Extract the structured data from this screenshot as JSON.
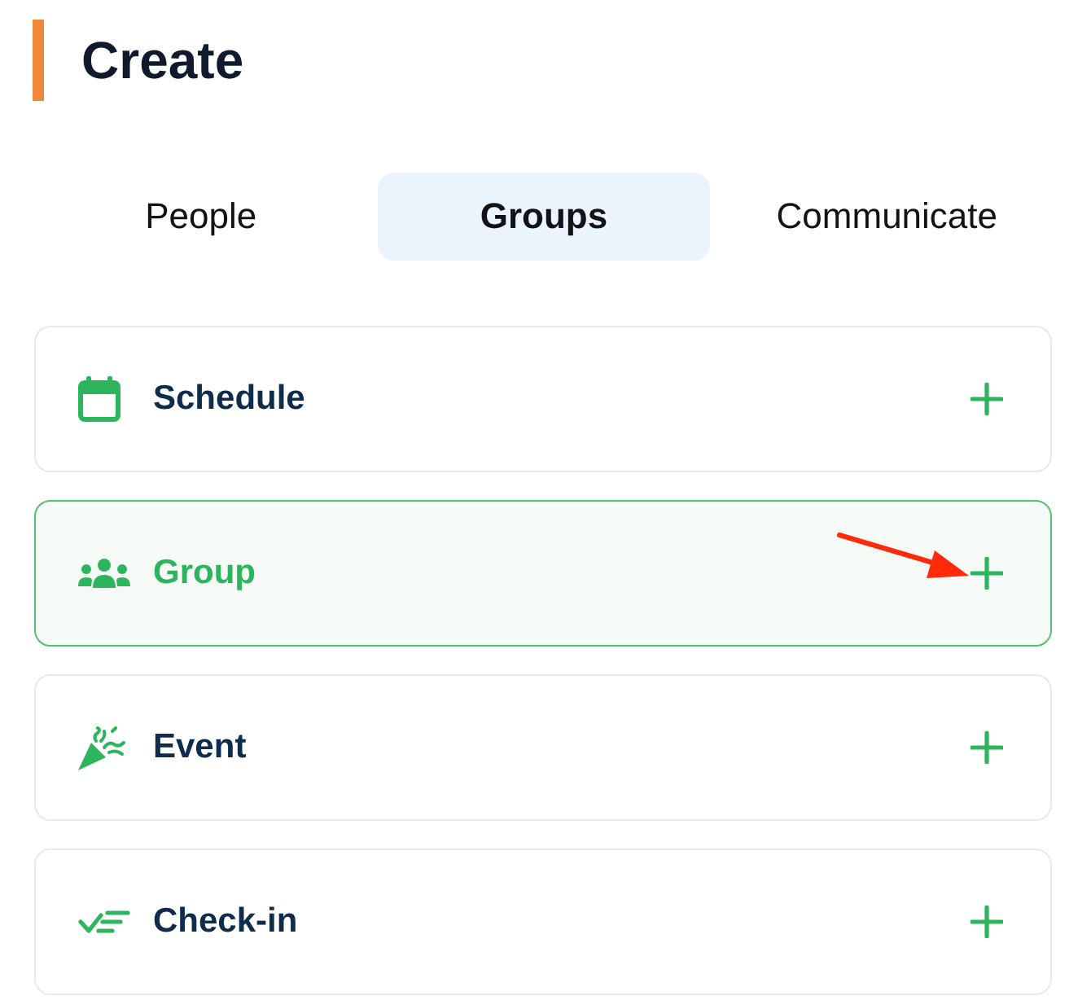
{
  "header": {
    "title": "Create"
  },
  "tabs": [
    {
      "label": "People",
      "selected": false
    },
    {
      "label": "Groups",
      "selected": true
    },
    {
      "label": "Communicate",
      "selected": false
    }
  ],
  "items": [
    {
      "kind": "schedule",
      "label": "Schedule",
      "selected": false,
      "arrow": false
    },
    {
      "kind": "group",
      "label": "Group",
      "selected": true,
      "arrow": true
    },
    {
      "kind": "event",
      "label": "Event",
      "selected": false,
      "arrow": false
    },
    {
      "kind": "checkin",
      "label": "Check-in",
      "selected": false,
      "arrow": false
    }
  ]
}
